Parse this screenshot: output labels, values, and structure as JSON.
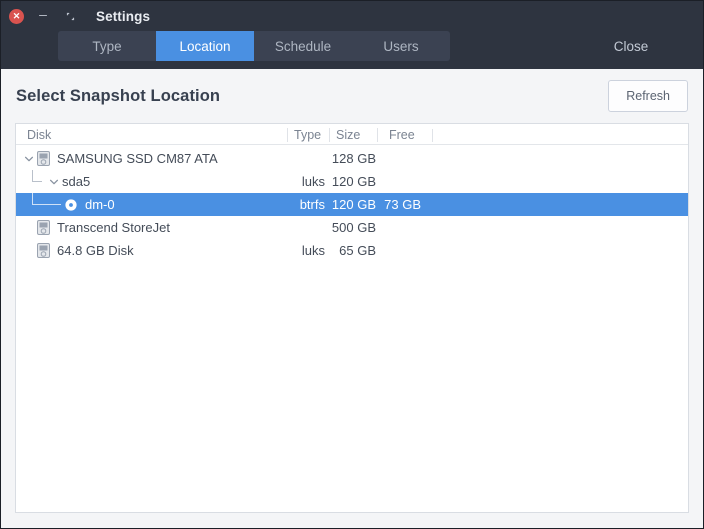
{
  "window": {
    "title": "Settings",
    "controls": {
      "close": "close-window-icon",
      "minimize": "minimize-window-icon",
      "maximize": "maximize-window-icon"
    }
  },
  "tabs": [
    {
      "label": "Type",
      "active": false
    },
    {
      "label": "Location",
      "active": true
    },
    {
      "label": "Schedule",
      "active": false
    },
    {
      "label": "Users",
      "active": false
    }
  ],
  "close_action": {
    "label": "Close"
  },
  "page": {
    "title": "Select Snapshot Location",
    "refresh_label": "Refresh"
  },
  "tree": {
    "columns": {
      "disk": "Disk",
      "type": "Type",
      "size": "Size",
      "free": "Free"
    },
    "rows": [
      {
        "name": "SAMSUNG SSD CM87 ATA",
        "type": "",
        "size": "128 GB",
        "free": "",
        "depth": 0,
        "icon": "drive-icon",
        "expander": "chevron-down-icon",
        "elbow": "none",
        "selected": false
      },
      {
        "name": "sda5",
        "type": "luks",
        "size": "120 GB",
        "free": "",
        "depth": 1,
        "icon": "none",
        "expander": "chevron-down-icon",
        "elbow": "short",
        "selected": false
      },
      {
        "name": "dm-0",
        "type": "btrfs",
        "size": "120 GB",
        "free": "73 GB",
        "depth": 2,
        "icon": "partition-icon",
        "expander": "none",
        "elbow": "long",
        "selected": true
      },
      {
        "name": "Transcend StoreJet",
        "type": "",
        "size": "500 GB",
        "free": "",
        "depth": 0,
        "icon": "drive-icon",
        "expander": "none",
        "elbow": "none",
        "selected": false
      },
      {
        "name": "64.8 GB Disk",
        "type": "luks",
        "size": "65 GB",
        "free": "",
        "depth": 0,
        "icon": "drive-icon",
        "expander": "none",
        "elbow": "none",
        "selected": false
      }
    ]
  },
  "colors": {
    "titlebar_bg": "#2e3440",
    "tabstrip_bg": "#3b4252",
    "accent": "#4a90e2",
    "content_bg": "#f4f5f7",
    "panel_bg": "#ffffff",
    "close_btn": "#d9534f"
  }
}
